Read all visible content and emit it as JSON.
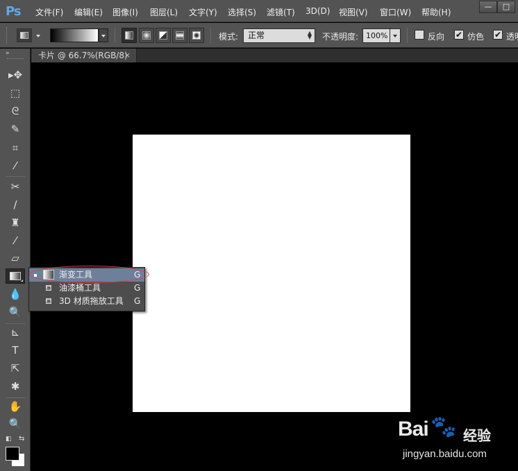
{
  "app": {
    "logo": "Ps",
    "menu": [
      "文件(F)",
      "编辑(E)",
      "图像(I)",
      "图层(L)",
      "文字(Y)",
      "选择(S)",
      "滤镜(T)",
      "3D(D)",
      "视图(V)",
      "窗口(W)",
      "帮助(H)"
    ],
    "window_buttons": {
      "minimize": "—",
      "restore": "□"
    }
  },
  "options": {
    "mode_label": "模式:",
    "mode_value": "正常",
    "opacity_label": "不透明度:",
    "opacity_value": "100%",
    "reverse_label": "反向",
    "reverse_checked": false,
    "dither_label": "仿色",
    "dither_checked": true,
    "transparency_label": "透明",
    "transparency_checked": true,
    "gradient_types": [
      "linear-gradient-icon",
      "radial-gradient-icon",
      "angle-gradient-icon",
      "reflected-gradient-icon",
      "diamond-gradient-icon"
    ],
    "active_gradient_type": 0
  },
  "document": {
    "tab_title": "卡片 @ 66.7%(RGB/8)",
    "tab_close": "×",
    "canvas_color": "#ffffff",
    "workspace_color": "#000000"
  },
  "toolbar": {
    "collapse_glyph": "»",
    "tools": [
      {
        "name": "move-tool-icon",
        "glyph": "▸✥"
      },
      {
        "name": "marquee-tool-icon",
        "glyph": "⬚"
      },
      {
        "name": "lasso-tool-icon",
        "glyph": "ᘓ"
      },
      {
        "name": "quick-select-tool-icon",
        "glyph": "✎"
      },
      {
        "name": "crop-tool-icon",
        "glyph": "⌗"
      },
      {
        "name": "eyedropper-tool-icon",
        "glyph": "⁄"
      },
      {
        "name": "healing-tool-icon",
        "glyph": "✂"
      },
      {
        "name": "brush-tool-icon",
        "glyph": "∕"
      },
      {
        "name": "stamp-tool-icon",
        "glyph": "♜"
      },
      {
        "name": "history-brush-tool-icon",
        "glyph": "⁄"
      },
      {
        "name": "eraser-tool-icon",
        "glyph": "▱"
      },
      {
        "name": "gradient-tool-icon",
        "glyph": ""
      },
      {
        "name": "blur-tool-icon",
        "glyph": "💧"
      },
      {
        "name": "dodge-tool-icon",
        "glyph": "🔍"
      },
      {
        "name": "pen-tool-icon",
        "glyph": "⊾"
      },
      {
        "name": "type-tool-icon",
        "glyph": "T"
      },
      {
        "name": "path-select-tool-icon",
        "glyph": "⇱"
      },
      {
        "name": "shape-tool-icon",
        "glyph": "✱"
      },
      {
        "name": "hand-tool-icon",
        "glyph": "✋"
      },
      {
        "name": "zoom-tool-icon",
        "glyph": "🔍"
      }
    ],
    "active_tool": "gradient-tool-icon",
    "foreground_color": "#000000",
    "background_color": "#ffffff"
  },
  "flyout": {
    "items": [
      {
        "label": "渐变工具",
        "shortcut": "G",
        "icon": "gradient-tool-icon",
        "selected": true
      },
      {
        "label": "油漆桶工具",
        "shortcut": "G",
        "icon": "paint-bucket-icon",
        "selected": false
      },
      {
        "label": "3D 材质拖放工具",
        "shortcut": "G",
        "icon": "3d-material-drop-icon",
        "selected": false
      }
    ],
    "highlight_color": "#d6404a"
  },
  "watermark": {
    "brand": "Bai",
    "brand_suffix": "经验",
    "url": "jingyan.baidu.com"
  }
}
